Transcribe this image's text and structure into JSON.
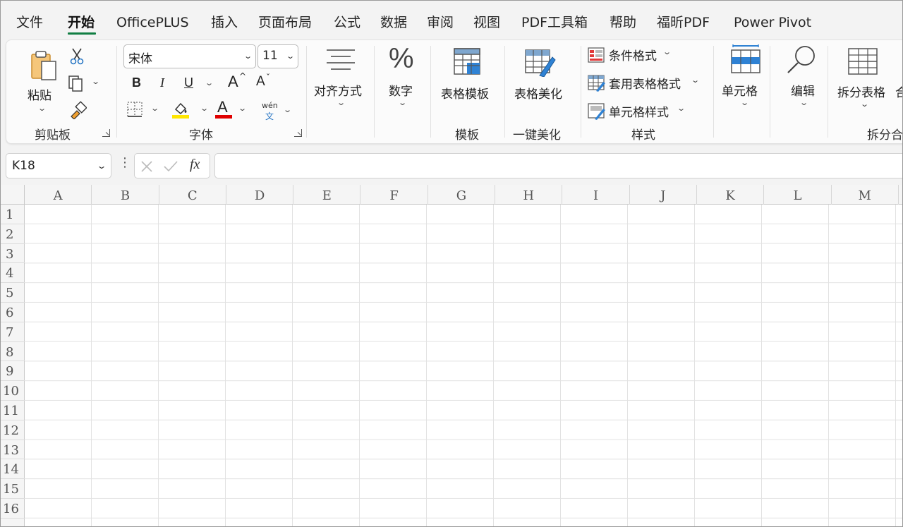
{
  "menu": {
    "tabs": [
      "文件",
      "开始",
      "OfficePLUS",
      "插入",
      "页面布局",
      "公式",
      "数据",
      "审阅",
      "视图",
      "PDF工具箱",
      "帮助",
      "福昕PDF",
      "Power Pivot"
    ],
    "active": "开始"
  },
  "ribbon": {
    "clipboard": {
      "paste_label": "粘贴",
      "group_label": "剪贴板"
    },
    "font": {
      "font_name": "宋体",
      "font_size": "11",
      "bold": "B",
      "italic": "I",
      "underline": "U",
      "grow": "A",
      "shrink": "A",
      "font_color_letter": "A",
      "phonetic_top": "wén",
      "phonetic_bottom": "文",
      "group_label": "字体",
      "fill_color": "#ffe600",
      "font_color": "#e00000"
    },
    "alignment": {
      "label": "对齐方式"
    },
    "number": {
      "label": "数字",
      "icon_text": "%"
    },
    "template": {
      "button_label": "表格模板",
      "group_label": "模板"
    },
    "beautify": {
      "button_label": "表格美化",
      "group_label": "一键美化"
    },
    "styles": {
      "conditional": "条件格式",
      "table_format": "套用表格格式",
      "cell_style": "单元格样式",
      "group_label": "样式"
    },
    "cells": {
      "label": "单元格"
    },
    "editing": {
      "label": "编辑"
    },
    "split": {
      "button_label": "拆分表格",
      "extra": "合",
      "group_label": "拆分合"
    }
  },
  "formula_bar": {
    "name_box": "K18",
    "fx": "fx",
    "formula": ""
  },
  "sheet": {
    "columns": [
      "A",
      "B",
      "C",
      "D",
      "E",
      "F",
      "G",
      "H",
      "I",
      "J",
      "K",
      "L",
      "M"
    ],
    "rows": [
      "1",
      "2",
      "3",
      "4",
      "5",
      "6",
      "7",
      "8",
      "9",
      "10",
      "11",
      "12",
      "13",
      "14",
      "15",
      "16"
    ],
    "accent_color": "#117e43"
  }
}
